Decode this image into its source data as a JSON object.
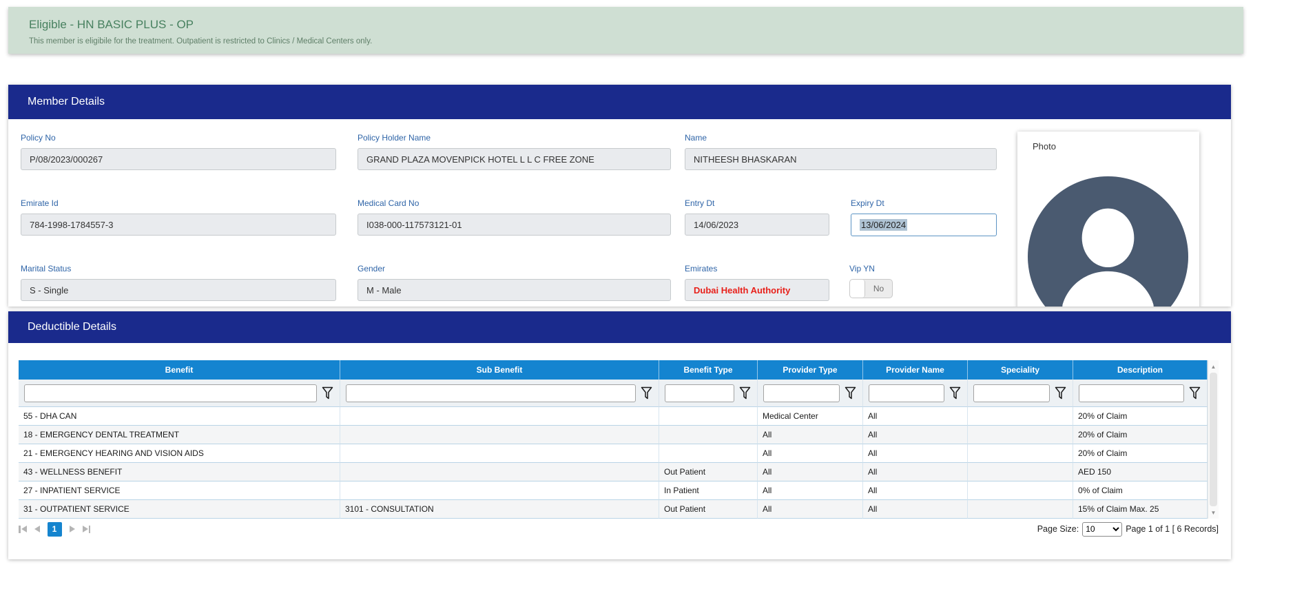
{
  "banner": {
    "title": "Eligible - HN BASIC PLUS - OP",
    "message": "This member is eligibile for the treatment. Outpatient is restricted to Clinics / Medical Centers only."
  },
  "member_details": {
    "title": "Member Details",
    "fields": {
      "policy_no": {
        "label": "Policy No",
        "value": "P/08/2023/000267"
      },
      "policy_holder_name": {
        "label": "Policy Holder Name",
        "value": "GRAND PLAZA MOVENPICK HOTEL L L C FREE ZONE"
      },
      "name": {
        "label": "Name",
        "value": "NITHEESH BHASKARAN"
      },
      "emirate_id": {
        "label": "Emirate Id",
        "value": "784-1998-1784557-3"
      },
      "medical_card_no": {
        "label": "Medical Card No",
        "value": "I038-000-117573121-01"
      },
      "entry_dt": {
        "label": "Entry Dt",
        "value": "14/06/2023"
      },
      "expiry_dt": {
        "label": "Expiry Dt",
        "value": "13/06/2024"
      },
      "marital_status": {
        "label": "Marital Status",
        "value": "S - Single"
      },
      "gender": {
        "label": "Gender",
        "value": "M - Male"
      },
      "emirates": {
        "label": "Emirates",
        "value": "Dubai Health Authority"
      },
      "vip_yn": {
        "label": "Vip YN",
        "value": "No"
      },
      "photo": {
        "label": "Photo"
      }
    }
  },
  "deductible_details": {
    "title": "Deductible Details",
    "table": {
      "columns": [
        "Benefit",
        "Sub Benefit",
        "Benefit Type",
        "Provider Type",
        "Provider Name",
        "Speciality",
        "Description"
      ],
      "rows": [
        [
          "55 - DHA CAN",
          "",
          "",
          "Medical Center",
          "All",
          "",
          "20% of Claim"
        ],
        [
          "18 - EMERGENCY DENTAL TREATMENT",
          "",
          "",
          "All",
          "All",
          "",
          "20% of Claim"
        ],
        [
          "21 - EMERGENCY HEARING AND VISION AIDS",
          "",
          "",
          "All",
          "All",
          "",
          "20% of Claim"
        ],
        [
          "43 - WELLNESS BENEFIT",
          "",
          "Out Patient",
          "All",
          "All",
          "",
          "AED 150"
        ],
        [
          "27 - INPATIENT SERVICE",
          "",
          "In Patient",
          "All",
          "All",
          "",
          "0% of Claim"
        ],
        [
          "31 - OUTPATIENT SERVICE",
          "3101 - CONSULTATION",
          "Out Patient",
          "All",
          "All",
          "",
          "15% of Claim Max. 25"
        ]
      ]
    },
    "pagination": {
      "current_page": "1",
      "page_size_label": "Page Size:",
      "page_size": "10",
      "summary": "Page 1 of 1 [ 6 Records]"
    }
  },
  "colors": {
    "panel_header_navy": "#1a2a8c",
    "table_header_blue": "#1484d0",
    "banner_green_bg": "#cfdfd3",
    "banner_green_text": "#47805f",
    "label_blue": "#2e64a7",
    "emirates_red": "#e8201a",
    "avatar_slate": "#4a5a70",
    "active_page_blue": "#1584ce"
  }
}
